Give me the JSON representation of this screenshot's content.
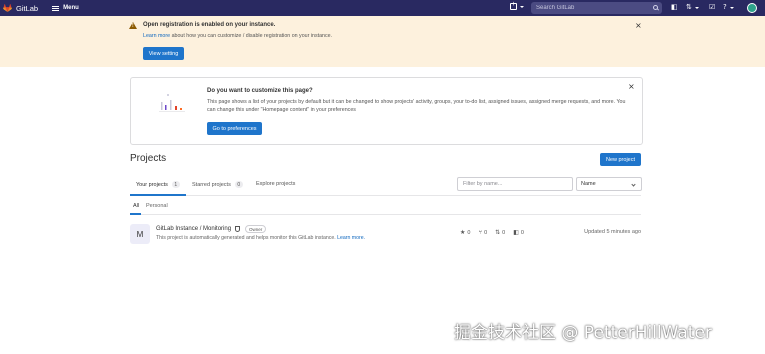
{
  "topbar": {
    "brand": "GitLab",
    "menu_label": "Menu",
    "search_placeholder": "Search GitLab"
  },
  "banner": {
    "title": "Open registration is enabled on your instance.",
    "link_text": "Learn more",
    "text_rest": " about how you can customize / disable registration on your instance.",
    "button_label": "View setting"
  },
  "callout": {
    "title": "Do you want to customize this page?",
    "body": "This page shows a list of your projects by default but it can be changed to show projects' activity, groups, your to-do list, assigned issues, assigned merge requests, and more. You can change this under \"Homepage content\" in your preferences",
    "button_label": "Go to preferences"
  },
  "projects": {
    "title": "Projects",
    "new_project_label": "New project",
    "tabs": [
      {
        "label": "Your projects",
        "count": "1"
      },
      {
        "label": "Starred projects",
        "count": "0"
      },
      {
        "label": "Explore projects",
        "count": ""
      }
    ],
    "filter_placeholder": "Filter by name...",
    "sort_label": "Name",
    "subtabs": [
      {
        "label": "All"
      },
      {
        "label": "Personal"
      }
    ],
    "items": [
      {
        "avatar_letter": "M",
        "name": "GitLab Instance / Monitoring",
        "badge": "Owner",
        "description": "This project is automatically generated and helps monitor this GitLab instance. ",
        "description_link": "Learn more.",
        "stars": "0",
        "forks": "0",
        "merge_requests": "0",
        "issues": "0",
        "updated": "Updated 5 minutes ago"
      }
    ]
  },
  "watermark": "掘金技术社区 @ PetterHillWater",
  "colors": {
    "nav_bg": "#292961",
    "banner_bg": "#fdf1dd",
    "primary": "#1f75cb",
    "link": "#1068bf"
  },
  "icons": [
    "gitlab-logo-icon",
    "menu-icon",
    "plus-icon",
    "search-icon",
    "issues-icon",
    "merge-request-icon",
    "todo-icon",
    "help-icon",
    "warning-icon",
    "close-icon",
    "shield-icon",
    "star-icon",
    "fork-icon",
    "merge-request-icon",
    "issue-icon"
  ]
}
